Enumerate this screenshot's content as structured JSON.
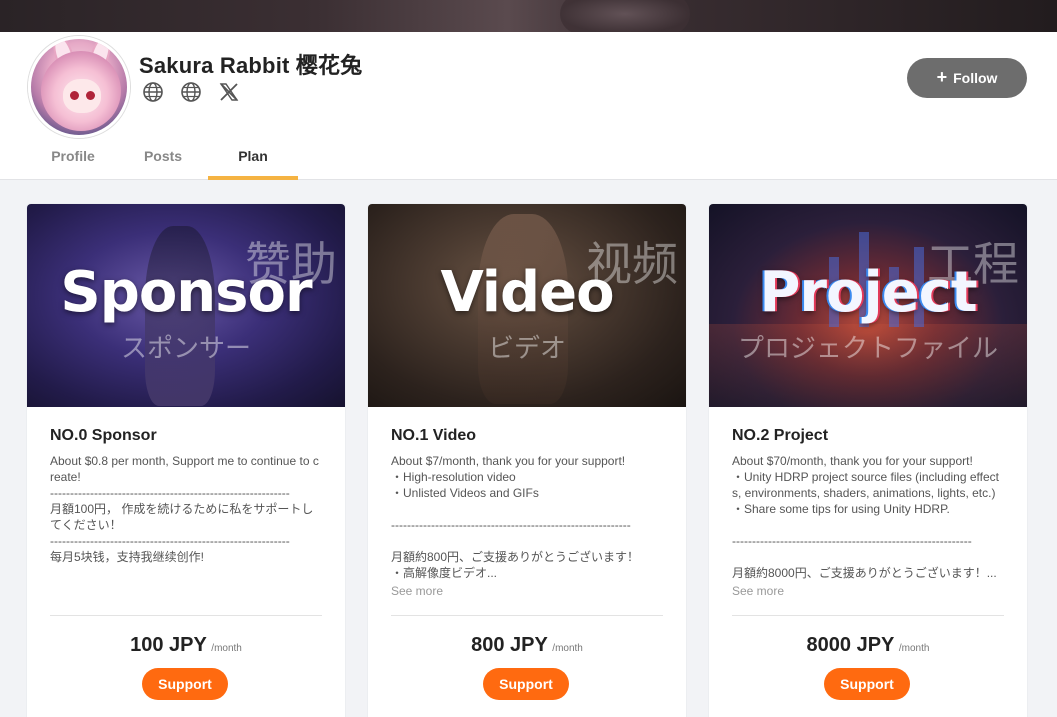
{
  "creator": {
    "name": "Sakura Rabbit 樱花兔",
    "social_icons": [
      "globe-icon",
      "globe-icon",
      "x-icon"
    ]
  },
  "follow": {
    "label": "Follow",
    "icon": "plus-icon"
  },
  "tabs": [
    {
      "label": "Profile",
      "active": false
    },
    {
      "label": "Posts",
      "active": false
    },
    {
      "label": "Plan",
      "active": true
    }
  ],
  "colors": {
    "accent_tab": "#f5b342",
    "support_button": "#ff6a10",
    "follow_button": "#6d6d6d"
  },
  "plans": [
    {
      "banner": {
        "title": "Sponsor",
        "chinese": "赞助",
        "japanese": "スポンサー"
      },
      "title": "NO.0 Sponsor",
      "description": [
        "About $0.8 per month, Support me to continue to create!",
        "------------------------------------------------------------",
        "月額100円， 作成を続けるために私をサポートしてください！",
        "------------------------------------------------------------",
        "每月5块钱，支持我继续创作!"
      ],
      "see_more": "",
      "price": "100 JPY",
      "per": "/month",
      "button": "Support"
    },
    {
      "banner": {
        "title": "Video",
        "chinese": "视频",
        "japanese": "ビデオ"
      },
      "title": "NO.1 Video",
      "description": [
        "About $7/month, thank you for your support!",
        "・High-resolution video",
        "・Unlisted Videos and GIFs",
        "",
        "------------------------------------------------------------",
        "",
        "月額約800円、ご支援ありがとうございます！",
        "・高解像度ビデオ..."
      ],
      "see_more": "See more",
      "price": "800 JPY",
      "per": "/month",
      "button": "Support"
    },
    {
      "banner": {
        "title": "Project",
        "chinese": "工程",
        "japanese": "プロジェクトファイル"
      },
      "title": "NO.2 Project",
      "description": [
        "About $70/month, thank you for your support!",
        "・Unity HDRP project source files (including effects, environments, shaders, animations, lights, etc.)",
        "・Share some tips for using Unity HDRP.",
        "",
        "------------------------------------------------------------",
        "",
        "月額約8000円、ご支援ありがとうございます！..."
      ],
      "see_more": "See more",
      "price": "8000 JPY",
      "per": "/month",
      "button": "Support"
    }
  ]
}
